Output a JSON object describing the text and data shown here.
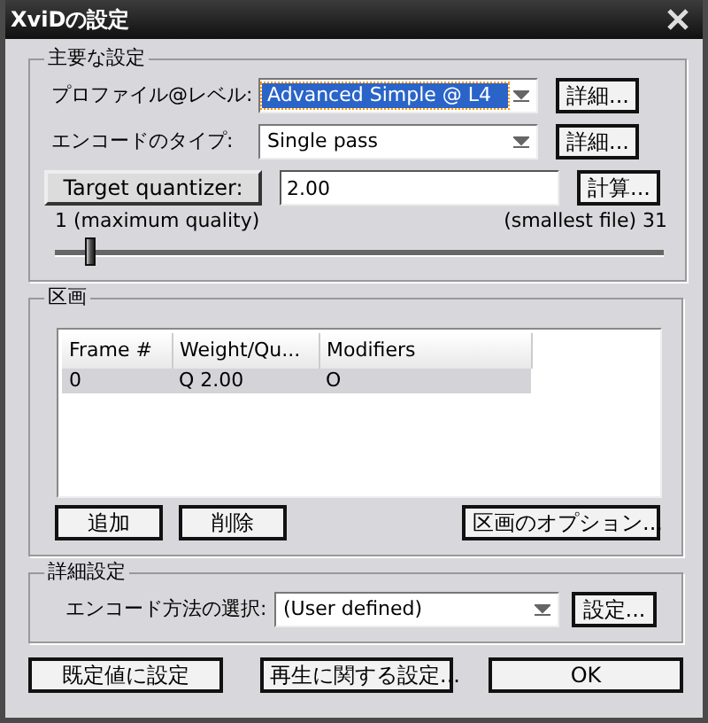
{
  "window": {
    "title": "XviDの設定"
  },
  "main_settings": {
    "title": "主要な設定",
    "rows": [
      {
        "label": "プロファイル@レベル:",
        "value": "Advanced Simple @ L4",
        "focused": true,
        "button": "詳細..."
      },
      {
        "label": "エンコードのタイプ:",
        "value": "Single pass",
        "focused": false,
        "button": "詳細..."
      }
    ],
    "quantizer": {
      "button": "Target quantizer:",
      "value": "2.00",
      "calc_button": "計算..."
    },
    "slider": {
      "min_label": "1 (maximum quality)",
      "max_label": "(smallest file) 31",
      "level": 0.03
    }
  },
  "zones": {
    "title": "区画",
    "columns": [
      "Frame #",
      "Weight/Qu...",
      "Modifiers"
    ],
    "rows": [
      {
        "cells": [
          "0",
          "Q 2.00",
          "O"
        ],
        "selected": true
      }
    ],
    "buttons": [
      "追加",
      "削除",
      "区画のオプション..."
    ]
  },
  "advanced": {
    "title": "詳細設定",
    "label": "エンコード方法の選択:",
    "value": "(User defined)",
    "button": "設定..."
  },
  "buttons": [
    "既定値に設定",
    "再生に関する設定...",
    "OK"
  ]
}
